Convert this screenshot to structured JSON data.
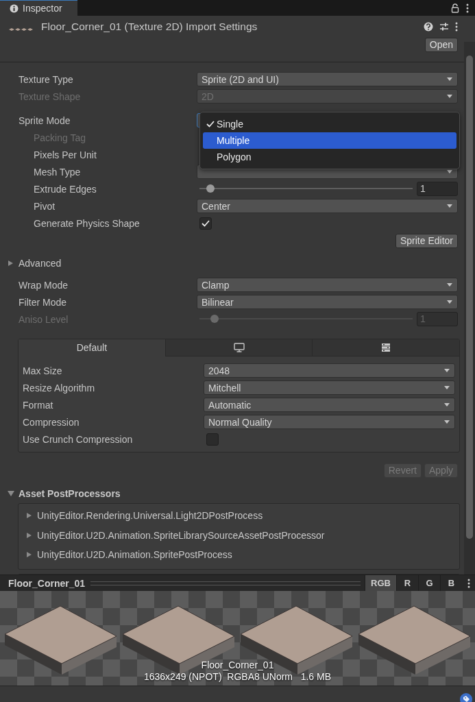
{
  "tab": {
    "title": "Inspector",
    "selected": true
  },
  "header": {
    "title": "Floor_Corner_01 (Texture 2D) Import Settings",
    "button": "Open"
  },
  "properties": [
    {
      "label": "Texture Type",
      "kind": "dropdown",
      "value": "Sprite (2D and UI)",
      "disabled": false
    },
    {
      "label": "Texture Shape",
      "kind": "dropdown",
      "value": "2D",
      "disabled": true
    },
    {
      "label": "Sprite Mode",
      "kind": "dropdown",
      "disabled": false,
      "focused": true,
      "menu": {
        "items": [
          {
            "label": "Single",
            "checked": true,
            "selected": false
          },
          {
            "label": "Multiple",
            "checked": false,
            "selected": true
          },
          {
            "label": "Polygon",
            "checked": false,
            "selected": false
          }
        ]
      },
      "children": [
        {
          "label": "Packing Tag",
          "disabled": true
        },
        {
          "label": "Pixels Per Unit",
          "disabled": false
        },
        {
          "label": "Mesh Type",
          "kind": "dropdown",
          "disabled": false
        },
        {
          "label": "Extrude Edges",
          "kind": "slider",
          "level": 0.05,
          "value": "1",
          "disabled": false
        },
        {
          "label": "Pivot",
          "kind": "dropdown",
          "value": "Center",
          "disabled": false
        },
        {
          "label": "Generate Physics Shape",
          "kind": "checkbox",
          "checked": true,
          "disabled": false
        }
      ]
    }
  ],
  "sprite_editor_button": "Sprite Editor",
  "advanced": {
    "label": "Advanced",
    "expanded": false
  },
  "sampling": [
    {
      "label": "Wrap Mode",
      "kind": "dropdown",
      "value": "Clamp",
      "disabled": false
    },
    {
      "label": "Filter Mode",
      "kind": "dropdown",
      "value": "Bilinear",
      "disabled": false
    },
    {
      "label": "Aniso Level",
      "kind": "slider",
      "level": 0.07,
      "value": "1",
      "disabled": true
    }
  ],
  "platform_tabs": [
    {
      "label": "Default",
      "selected": true
    },
    {
      "kind": "monitor",
      "selected": false
    },
    {
      "kind": "server",
      "selected": false
    }
  ],
  "platform_settings": [
    {
      "label": "Max Size",
      "kind": "dropdown",
      "value": "2048",
      "disabled": false
    },
    {
      "label": "Resize Algorithm",
      "kind": "dropdown",
      "value": "Mitchell",
      "disabled": false
    },
    {
      "label": "Format",
      "kind": "dropdown",
      "value": "Automatic",
      "disabled": false
    },
    {
      "label": "Compression",
      "kind": "dropdown",
      "value": "Normal Quality",
      "disabled": false
    },
    {
      "label": "Use Crunch Compression",
      "kind": "checkbox",
      "checked": false,
      "disabled": false
    }
  ],
  "action_buttons": [
    {
      "label": "Revert",
      "disabled": true
    },
    {
      "label": "Apply",
      "disabled": true
    }
  ],
  "asset_postprocessors": {
    "label": "Asset PostProcessors",
    "expanded": true,
    "items": [
      {
        "label": "UnityEditor.Rendering.Universal.Light2DPostProcess",
        "expanded": false
      },
      {
        "label": "UnityEditor.U2D.Animation.SpriteLibrarySourceAssetPostProcessor",
        "expanded": false
      },
      {
        "label": "UnityEditor.U2D.Animation.SpritePostProcess",
        "expanded": false
      }
    ]
  },
  "preview": {
    "name": "Floor_Corner_01",
    "channels": [
      {
        "label": "RGB",
        "selected": true
      },
      {
        "label": "R",
        "selected": false
      },
      {
        "label": "G",
        "selected": false
      },
      {
        "label": "B",
        "selected": false
      }
    ],
    "caption_name": "Floor_Corner_01",
    "caption_info": "1636x249 (NPOT)  RGBA8 UNorm   1.6 MB"
  }
}
